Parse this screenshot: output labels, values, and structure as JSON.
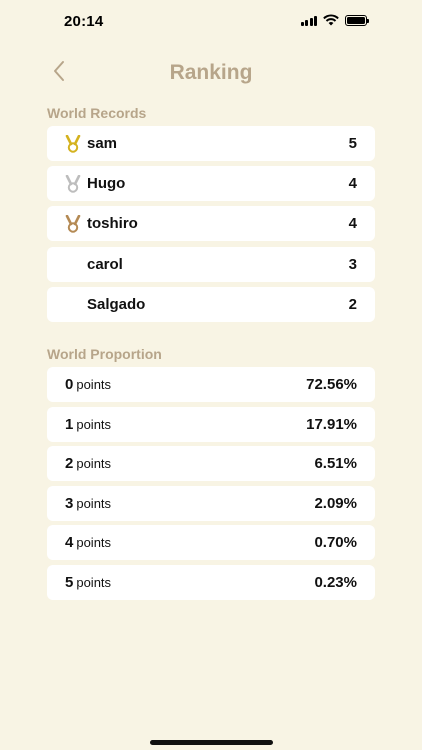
{
  "status_bar": {
    "time": "20:14"
  },
  "header": {
    "title": "Ranking",
    "back_icon": "chevron-left-icon"
  },
  "colors": {
    "background": "#f8f4e4",
    "accent": "#b7a58a",
    "gold": "#d4b21f",
    "silver": "#bdbdbd",
    "bronze": "#b48a54"
  },
  "world_records": {
    "title": "World Records",
    "items": [
      {
        "name": "sam",
        "score": "5",
        "medal": "gold-medal-icon"
      },
      {
        "name": "Hugo",
        "score": "4",
        "medal": "silver-medal-icon"
      },
      {
        "name": "toshiro",
        "score": "4",
        "medal": "bronze-medal-icon"
      },
      {
        "name": "carol",
        "score": "3",
        "medal": ""
      },
      {
        "name": "Salgado",
        "score": "2",
        "medal": ""
      }
    ]
  },
  "world_proportion": {
    "title": "World Proportion",
    "unit": "points",
    "items": [
      {
        "points": "0",
        "percent": "72.56%"
      },
      {
        "points": "1",
        "percent": "17.91%"
      },
      {
        "points": "2",
        "percent": "6.51%"
      },
      {
        "points": "3",
        "percent": "2.09%"
      },
      {
        "points": "4",
        "percent": "0.70%"
      },
      {
        "points": "5",
        "percent": "0.23%"
      }
    ]
  }
}
